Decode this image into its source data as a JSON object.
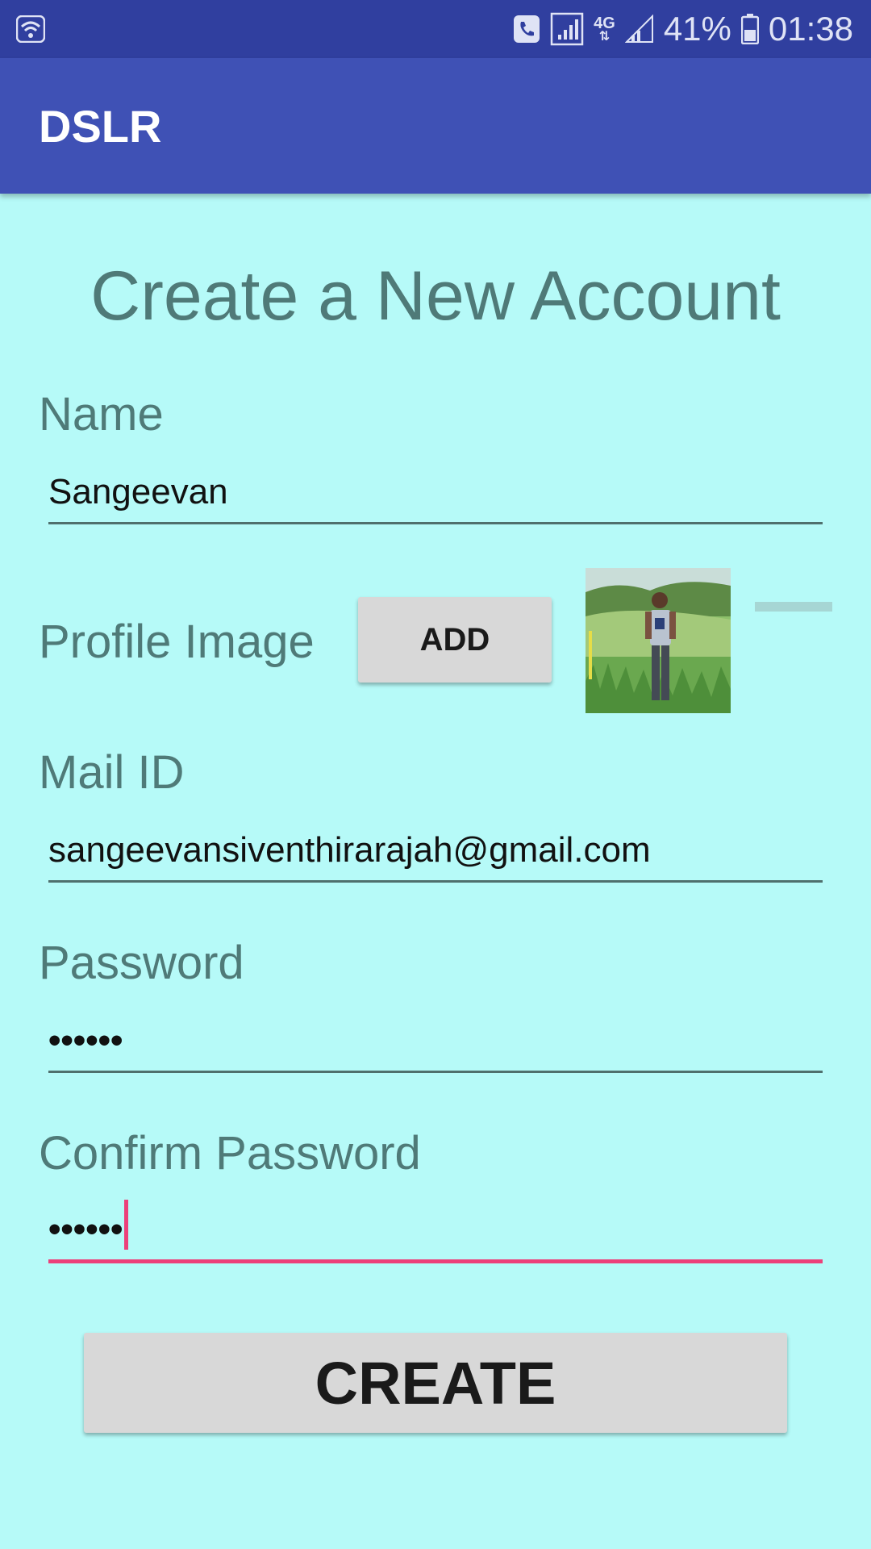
{
  "status_bar": {
    "battery_percent": "41%",
    "time": "01:38",
    "network_type": "4G",
    "icons": [
      "wifi-icon",
      "call-icon",
      "signal-bars-icon",
      "network-4g-icon",
      "signal-icon",
      "battery-icon"
    ]
  },
  "app_bar": {
    "title": "DSLR"
  },
  "form": {
    "heading": "Create a New Account",
    "name_label": "Name",
    "name_value": "Sangeevan",
    "profile_label": "Profile Image",
    "add_button": "ADD",
    "mail_label": "Mail ID",
    "mail_value": "sangeevansiventhirarajah@gmail.com",
    "password_label": "Password",
    "password_value": "••••••",
    "confirm_label": "Confirm Password",
    "confirm_value": "••••••",
    "create_button": "CREATE"
  },
  "colors": {
    "status_bar": "#303f9f",
    "app_bar": "#3f51b5",
    "background": "#b6faf8",
    "accent": "#ec407a",
    "label_text": "#4f7a78"
  }
}
